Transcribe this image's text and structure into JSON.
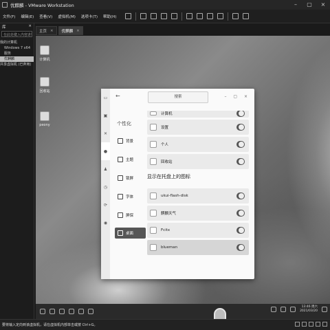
{
  "window": {
    "title": "优麒麟 - VMware Workstation"
  },
  "menu": [
    "文件(F)",
    "编辑(E)",
    "查看(V)",
    "虚拟机(M)",
    "选项卡(T)",
    "帮助(H)"
  ],
  "library": {
    "header": "库",
    "close": "×",
    "search_placeholder": "在此处键入内容进行搜索",
    "tree": [
      "我的计算机",
      "Windows 7 x64",
      "服务",
      "优麒麟",
      "共享虚拟机 (已弃用)"
    ]
  },
  "tabs": [
    {
      "label": "主页"
    },
    {
      "label": "优麒麟"
    }
  ],
  "desktop_icons": [
    {
      "label": "计算机",
      "icon": "computer-icon"
    },
    {
      "label": "回收站",
      "icon": "trash-icon"
    },
    {
      "label": "peony",
      "icon": "file-manager-icon"
    }
  ],
  "settings": {
    "back": "←",
    "search_placeholder": "搜索",
    "window_controls": "– ▢ ×",
    "nav_heading": "个性化",
    "nav": [
      {
        "label": "背景",
        "icon": "background-icon"
      },
      {
        "label": "主题",
        "icon": "theme-icon"
      },
      {
        "label": "锁屏",
        "icon": "lockscreen-icon"
      },
      {
        "label": "字体",
        "icon": "font-icon"
      },
      {
        "label": "屏保",
        "icon": "screensaver-icon"
      },
      {
        "label": "桌面",
        "icon": "desktop-icon"
      }
    ],
    "desktop_rows": [
      {
        "label": "计算机",
        "on": true
      },
      {
        "label": "设置",
        "on": true
      },
      {
        "label": "个人",
        "on": true
      },
      {
        "label": "回收站",
        "on": true
      }
    ],
    "tray_title": "显示在托盘上的图标",
    "tray_rows": [
      {
        "label": "ukui-flash-disk",
        "on": true
      },
      {
        "label": "麒麟天气",
        "on": true
      },
      {
        "label": "Fcitx",
        "on": true
      },
      {
        "label": "blueman",
        "on": true
      }
    ]
  },
  "clock": {
    "time": "13:46 周六",
    "date": "2021/03/20"
  },
  "statusbar": {
    "text": "要将输入定向到该虚拟机，请在虚拟机内部单击或按 Ctrl+G。"
  },
  "colors": {
    "accent": "#555555"
  }
}
